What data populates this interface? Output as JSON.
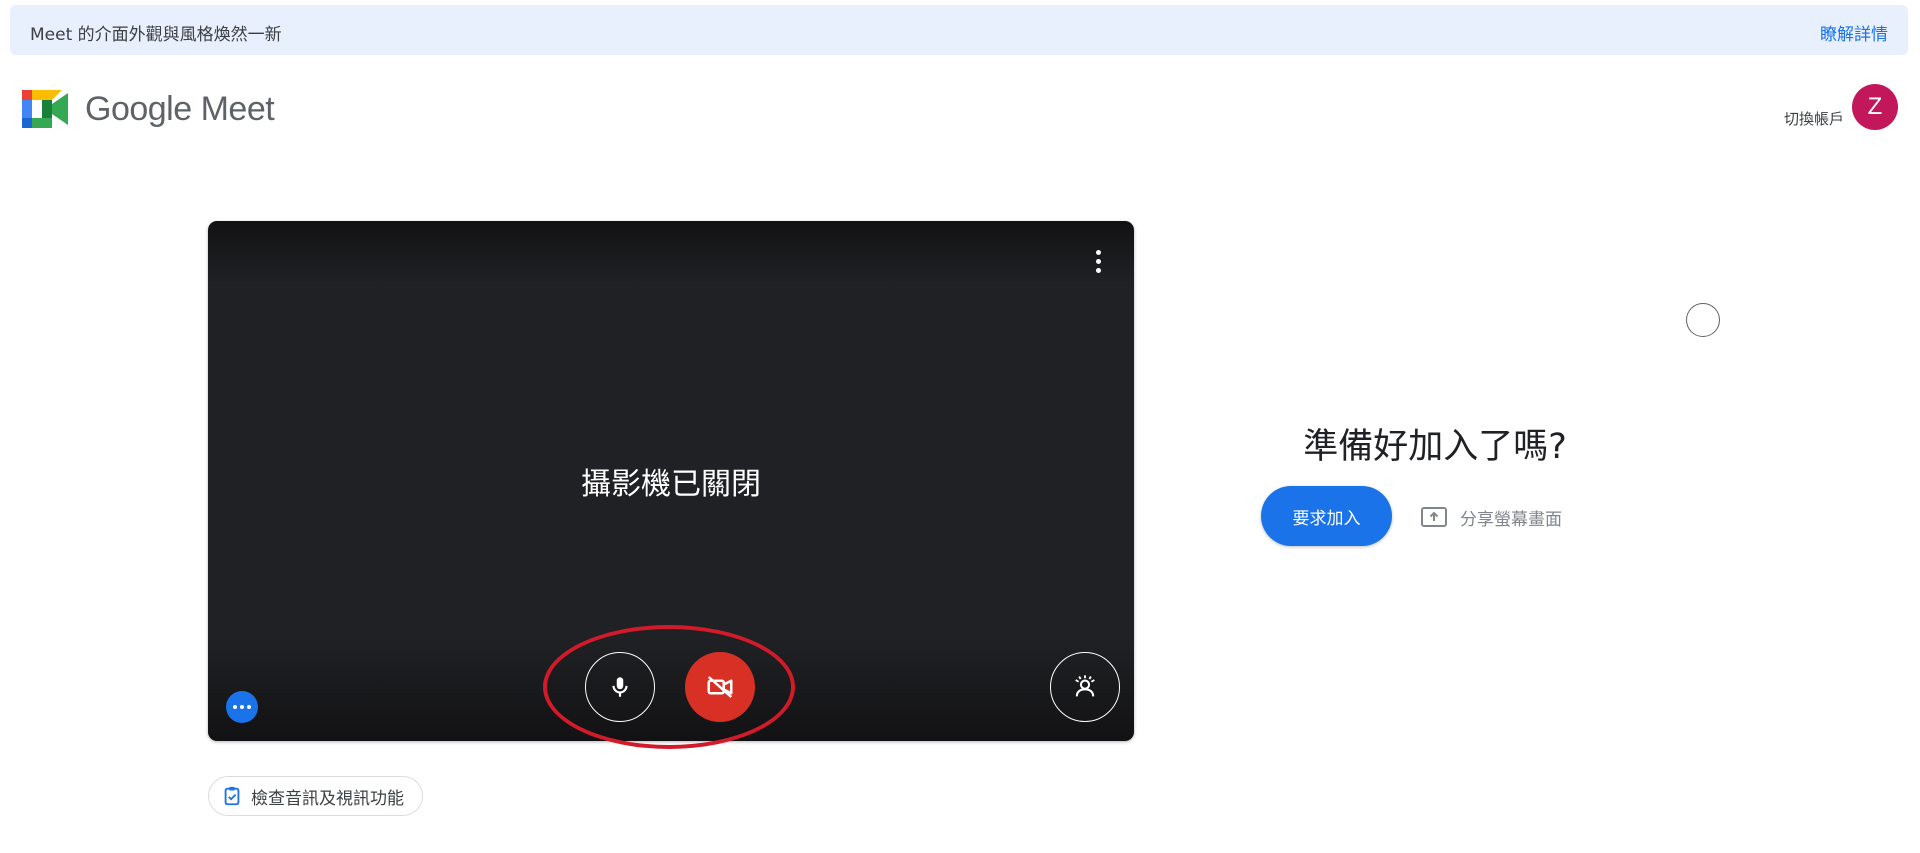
{
  "banner": {
    "message": "Meet 的介面外觀與風格煥然一新",
    "link": "瞭解詳情"
  },
  "header": {
    "logo_text": "Google Meet",
    "switch_account": "切換帳戶",
    "avatar_letter": "Z",
    "avatar_color": "#c2185b"
  },
  "preview": {
    "camera_off_text": "攝影機已關閉",
    "mic_state": "on",
    "camera_state": "off"
  },
  "check_av": {
    "label": "檢查音訊及視訊功能"
  },
  "join_panel": {
    "title": "準備好加入了嗎?",
    "join_label": "要求加入",
    "share_label": "分享螢幕畫面"
  },
  "colors": {
    "accent": "#1a73e8",
    "danger": "#d93025",
    "banner_bg": "#e8f0fe"
  }
}
